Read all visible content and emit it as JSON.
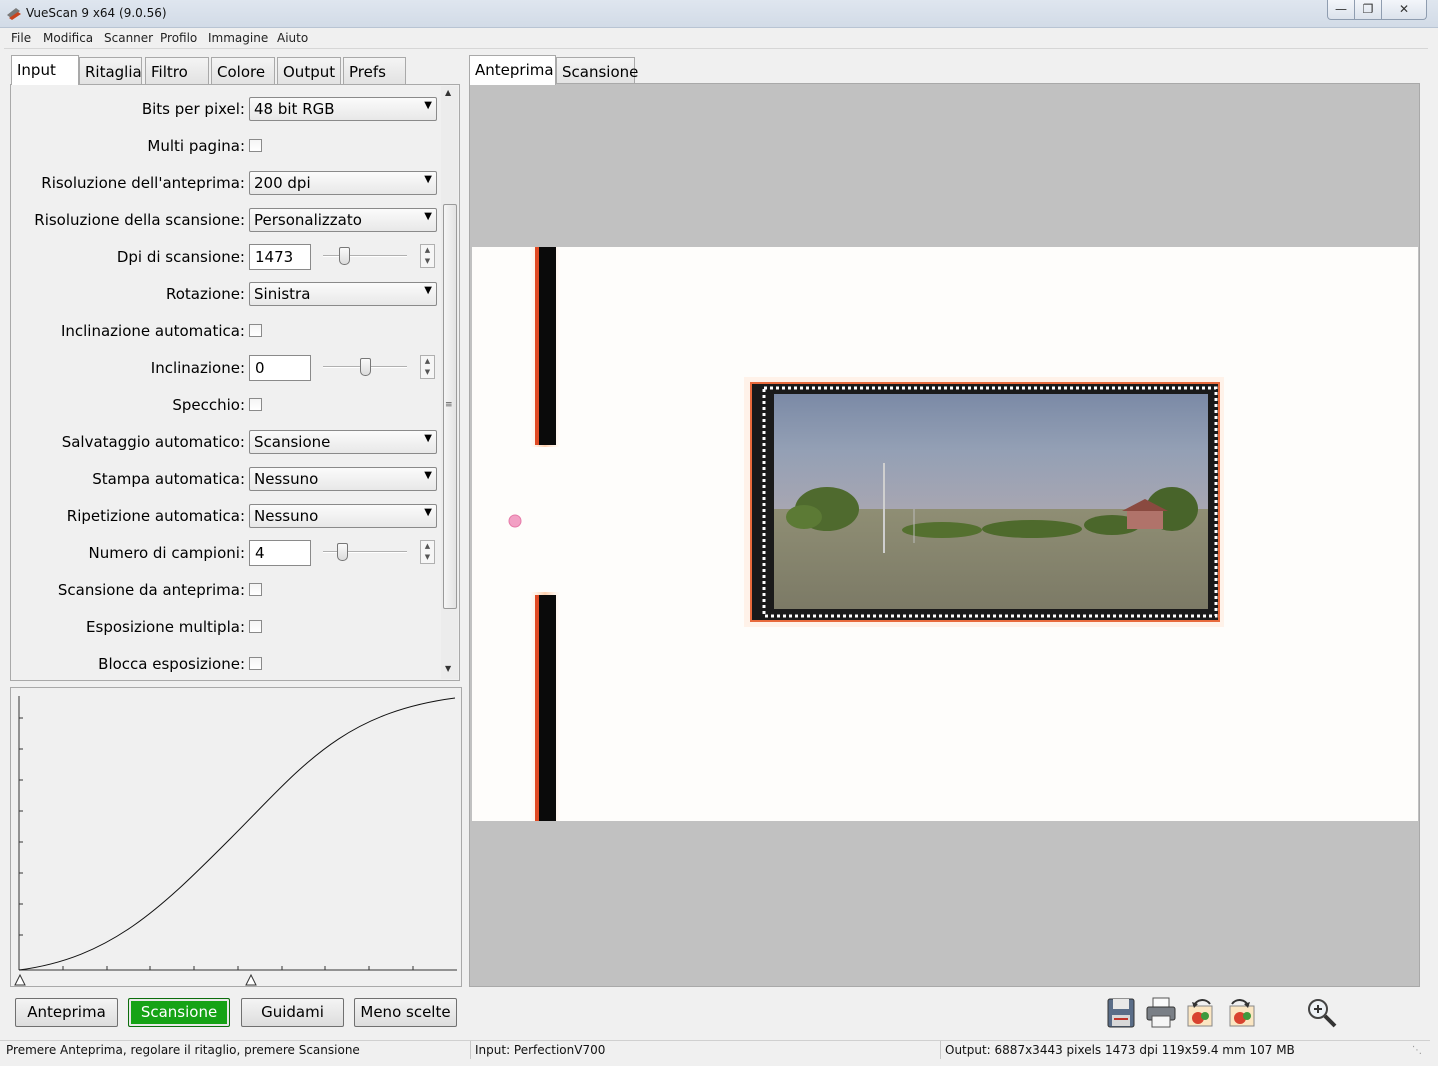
{
  "window": {
    "title": "VueScan 9 x64 (9.0.56)"
  },
  "menu": [
    "File",
    "Modifica",
    "Scanner",
    "Profilo",
    "Immagine",
    "Aiuto"
  ],
  "left_tabs": [
    "Input",
    "Ritaglia",
    "Filtro",
    "Colore",
    "Output",
    "Prefs"
  ],
  "right_tabs": [
    "Anteprima",
    "Scansione"
  ],
  "settings": {
    "bits": {
      "label": "Bits per pixel:",
      "value": "48 bit RGB"
    },
    "multi": {
      "label": "Multi pagina:"
    },
    "prev_res": {
      "label": "Risoluzione dell'anteprima:",
      "value": "200 dpi"
    },
    "scan_res": {
      "label": "Risoluzione della scansione:",
      "value": "Personalizzato"
    },
    "dpi": {
      "label": "Dpi di scansione:",
      "value": "1473"
    },
    "rotation": {
      "label": "Rotazione:",
      "value": "Sinistra"
    },
    "auto_skew": {
      "label": "Inclinazione automatica:"
    },
    "skew": {
      "label": "Inclinazione:",
      "value": "0"
    },
    "mirror": {
      "label": "Specchio:"
    },
    "auto_save": {
      "label": "Salvataggio automatico:",
      "value": "Scansione"
    },
    "auto_print": {
      "label": "Stampa automatica:",
      "value": "Nessuno"
    },
    "auto_repeat": {
      "label": "Ripetizione automatica:",
      "value": "Nessuno"
    },
    "samples": {
      "label": "Numero di campioni:",
      "value": "4"
    },
    "scan_from_preview": {
      "label": "Scansione da anteprima:"
    },
    "multi_exposure": {
      "label": "Esposizione multipla:"
    },
    "lock_exposure": {
      "label": "Blocca esposizione:"
    }
  },
  "buttons": {
    "preview": "Anteprima",
    "scan": "Scansione",
    "guide": "Guidami",
    "fewer": "Meno scelte"
  },
  "status": {
    "hint": "Premere Anteprima, regolare il ritaglio, premere Scansione",
    "input": "Input: PerfectionV700",
    "output": "Output: 6887x3443 pixels 1473 dpi 119x59.4 mm 107 MB"
  },
  "icons": [
    "save-icon",
    "print-icon",
    "rotate-left-icon",
    "rotate-right-icon",
    "zoom-icon"
  ],
  "colors": {
    "scan_button": "#15a315",
    "preview_bg": "#c1c1c1"
  }
}
